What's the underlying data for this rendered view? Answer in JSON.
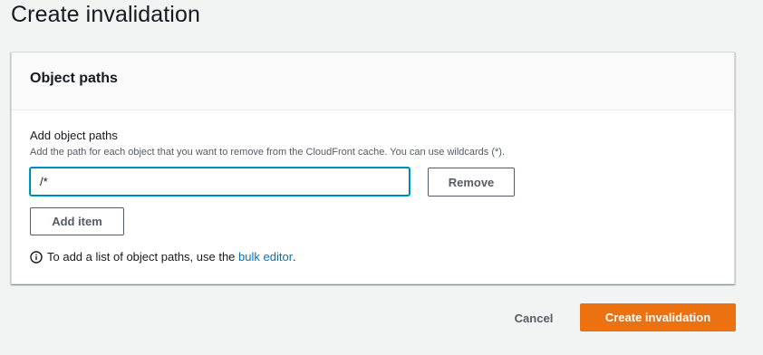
{
  "page": {
    "title": "Create invalidation"
  },
  "panel": {
    "title": "Object paths",
    "field_label": "Add object paths",
    "field_description": "Add the path for each object that you want to remove from the CloudFront cache. You can use wildcards (*).",
    "paths": [
      {
        "value": "/*",
        "remove_label": "Remove"
      }
    ],
    "add_item_label": "Add item",
    "info_text_before": "To add a list of object paths, use the",
    "info_link": "bulk editor",
    "info_text_after": "."
  },
  "footer": {
    "cancel_label": "Cancel",
    "submit_label": "Create invalidation"
  },
  "icons": {
    "info": "info-circle-icon"
  },
  "colors": {
    "primary": "#ec7211",
    "link": "#0073bb",
    "focus": "#00a1c9"
  }
}
